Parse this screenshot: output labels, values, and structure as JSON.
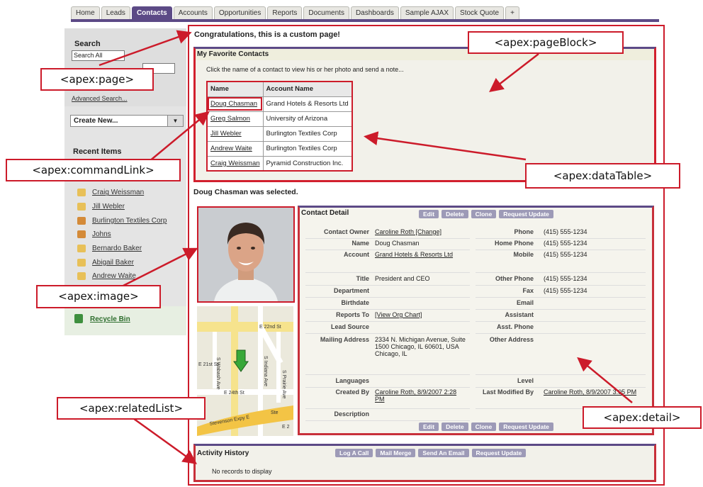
{
  "tabs": [
    "Home",
    "Leads",
    "Contacts",
    "Accounts",
    "Opportunities",
    "Reports",
    "Documents",
    "Dashboards",
    "Sample AJAX",
    "Stock Quote",
    "+"
  ],
  "active_tab": "Contacts",
  "sidebar": {
    "search_title": "Search",
    "search_scope": "Search All",
    "advanced_search": "Advanced Search...",
    "create_new": "Create New...",
    "recent_title": "Recent Items",
    "recent_items": [
      {
        "label": "Craig Weissman",
        "icon": "contact-icon"
      },
      {
        "label": "Jill Webler",
        "icon": "contact-icon"
      },
      {
        "label": "Burlington Textiles Corp",
        "icon": "account-icon"
      },
      {
        "label": "Johns",
        "icon": "account-icon"
      },
      {
        "label": "Bernardo Baker",
        "icon": "contact-icon"
      },
      {
        "label": "Abigail Baker",
        "icon": "contact-icon"
      },
      {
        "label": "Andrew Waite",
        "icon": "contact-icon"
      }
    ],
    "recycle_bin": "Recycle Bin"
  },
  "main": {
    "congrats": "Congratulations, this is a custom page!",
    "page_block_title": "My Favorite Contacts",
    "intro": "Click the name of a contact to view his or her photo and send a note...",
    "table_headers": [
      "Name",
      "Account Name"
    ],
    "table_rows": [
      [
        "Doug Chasman",
        "Grand Hotels & Resorts Ltd"
      ],
      [
        "Greg Salmon",
        "University of Arizona"
      ],
      [
        "Jill Webler",
        "Burlington Textiles Corp"
      ],
      [
        "Andrew Waite",
        "Burlington Textiles Corp"
      ],
      [
        "Craig Weissman",
        "Pyramid Construction Inc."
      ]
    ],
    "selected_msg": "Doug Chasman was selected.",
    "map_labels": [
      "E 22nd St",
      "E 21st St",
      "E 24th St",
      "S Wabash Ave",
      "S Indiana Ave",
      "S Prairie Ave",
      "Stevenson Expy E",
      "Ste",
      "E 2"
    ]
  },
  "detail": {
    "title": "Contact Detail",
    "buttons": [
      "Edit",
      "Delete",
      "Clone",
      "Request Update"
    ],
    "left_fields": [
      {
        "label": "Contact Owner",
        "value": "Caroline Roth [Change]",
        "link": true
      },
      {
        "label": "Name",
        "value": "Doug Chasman"
      },
      {
        "label": "Account",
        "value": "Grand Hotels & Resorts Ltd",
        "link": true
      },
      {
        "label": "Title",
        "value": "President and CEO"
      },
      {
        "label": "Department",
        "value": ""
      },
      {
        "label": "Birthdate",
        "value": ""
      },
      {
        "label": "Reports To",
        "value": "[View Org Chart]",
        "link": true
      },
      {
        "label": "Lead Source",
        "value": ""
      },
      {
        "label": "Mailing Address",
        "value": "2334 N. Michigan Avenue, Suite 1500 Chicago, IL 60601, USA Chicago, IL"
      },
      {
        "label": "Languages",
        "value": ""
      },
      {
        "label": "Created By",
        "value": "Caroline Roth, 8/9/2007 2:28 PM",
        "link": true
      },
      {
        "label": "Description",
        "value": ""
      }
    ],
    "right_fields": [
      {
        "label": "Phone",
        "value": "(415) 555-1234"
      },
      {
        "label": "Home Phone",
        "value": "(415) 555-1234"
      },
      {
        "label": "Mobile",
        "value": "(415) 555-1234"
      },
      {
        "label": "Other Phone",
        "value": "(415) 555-1234"
      },
      {
        "label": "Fax",
        "value": "(415) 555-1234"
      },
      {
        "label": "Email",
        "value": ""
      },
      {
        "label": "Assistant",
        "value": ""
      },
      {
        "label": "Asst. Phone",
        "value": ""
      },
      {
        "label": "Other Address",
        "value": ""
      },
      {
        "label": "Level",
        "value": ""
      },
      {
        "label": "Last Modified By",
        "value": "Caroline Roth, 8/9/2007 3:05 PM",
        "link": true
      }
    ]
  },
  "related": {
    "title": "Activity History",
    "buttons": [
      "Log A Call",
      "Mail Merge",
      "Send An Email",
      "Request Update"
    ],
    "empty": "No records to display"
  },
  "callouts": {
    "page": "<apex:page>",
    "pageBlock": "<apex:pageBlock>",
    "commandLink": "<apex:commandLink>",
    "dataTable": "<apex:dataTable>",
    "image": "<apex:image>",
    "relatedList": "<apex:relatedList>",
    "detail": "<apex:detail>"
  },
  "colors": {
    "accent": "#5c4a86",
    "annotation": "#cc1b2a"
  }
}
